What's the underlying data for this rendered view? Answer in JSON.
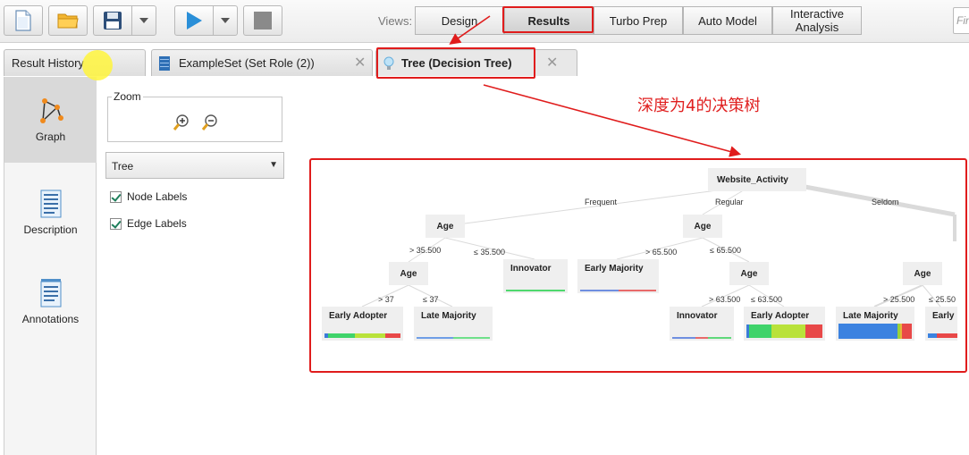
{
  "toolbar": {
    "views_label": "Views:",
    "view_buttons": [
      "Design",
      "Results",
      "Turbo Prep",
      "Auto Model",
      "Interactive Analysis"
    ],
    "active_view": "Results",
    "find_placeholder": "Fin"
  },
  "tabs": [
    {
      "label": "Result History"
    },
    {
      "label": "ExampleSet (Set Role (2))"
    },
    {
      "label": "Tree (Decision Tree)"
    }
  ],
  "nav": {
    "items": [
      {
        "label": "Graph",
        "icon": "graph-icon"
      },
      {
        "label": "Description",
        "icon": "description-icon"
      },
      {
        "label": "Annotations",
        "icon": "annotations-icon"
      }
    ]
  },
  "options": {
    "zoom_label": "Zoom",
    "layout_value": "Tree",
    "node_labels": "Node Labels",
    "edge_labels": "Edge Labels"
  },
  "annotation": {
    "text": "深度为4的决策树",
    "color": "#e02020"
  },
  "tree": {
    "nodes": [
      {
        "id": "root",
        "label": "Website_Activity"
      },
      {
        "id": "age_f",
        "label": "Age"
      },
      {
        "id": "age_r",
        "label": "Age"
      },
      {
        "id": "age_s",
        "label": "Age"
      },
      {
        "id": "age_f2",
        "label": "Age"
      },
      {
        "id": "age_r2",
        "label": "Age"
      }
    ],
    "leaves": [
      {
        "id": "l_innov1",
        "label": "Innovator",
        "bar": [
          {
            "c": "#4fd86e",
            "w": 1
          }
        ]
      },
      {
        "id": "l_early_maj",
        "label": "Early Majority",
        "bar": [
          {
            "c": "#6f8fe0",
            "w": 0.5
          },
          {
            "c": "#e86a6a",
            "w": 0.5
          }
        ]
      },
      {
        "id": "l_early_adopt1",
        "label": "Early Adopter",
        "bar": [
          {
            "c": "#3b7bd8",
            "w": 0.05
          },
          {
            "c": "#3fd36a",
            "w": 0.35
          },
          {
            "c": "#b9e23a",
            "w": 0.4
          },
          {
            "c": "#e84848",
            "w": 0.2
          }
        ]
      },
      {
        "id": "l_late_maj1",
        "label": "Late Majority",
        "bar": [
          {
            "c": "#6f9ee6",
            "w": 0.5
          },
          {
            "c": "#6fe08a",
            "w": 0.5
          }
        ]
      },
      {
        "id": "l_innov2",
        "label": "Innovator",
        "bar": [
          {
            "c": "#6f8fe0",
            "w": 0.4
          },
          {
            "c": "#e86a6a",
            "w": 0.2
          },
          {
            "c": "#5fd87a",
            "w": 0.4
          }
        ]
      },
      {
        "id": "l_early_adopt2",
        "label": "Early Adopter",
        "bar": [
          {
            "c": "#3b7bd8",
            "w": 0.03
          },
          {
            "c": "#3fd36a",
            "w": 0.3
          },
          {
            "c": "#b9e23a",
            "w": 0.45
          },
          {
            "c": "#e84848",
            "w": 0.22
          }
        ]
      },
      {
        "id": "l_late_maj2",
        "label": "Late Majority",
        "bar": [
          {
            "c": "#3b82e0",
            "w": 0.8
          },
          {
            "c": "#9ad23a",
            "w": 0.04
          },
          {
            "c": "#e8b33a",
            "w": 0.03
          },
          {
            "c": "#e84848",
            "w": 0.13
          }
        ]
      },
      {
        "id": "l_early3",
        "label": "Early",
        "bar": [
          {
            "c": "#3b82e0",
            "w": 0.3
          },
          {
            "c": "#e84848",
            "w": 0.7
          }
        ]
      }
    ],
    "edges": [
      {
        "label": "Frequent"
      },
      {
        "label": "Regular"
      },
      {
        "label": "Seldom"
      },
      {
        "label": "> 35.500"
      },
      {
        "label": "≤ 35.500"
      },
      {
        "label": "> 65.500"
      },
      {
        "label": "≤ 65.500"
      },
      {
        "label": "> 37"
      },
      {
        "label": "≤ 37"
      },
      {
        "label": "> 63.500"
      },
      {
        "label": "≤ 63.500"
      },
      {
        "label": "> 25.500"
      },
      {
        "label": "≤ 25.50"
      }
    ]
  }
}
